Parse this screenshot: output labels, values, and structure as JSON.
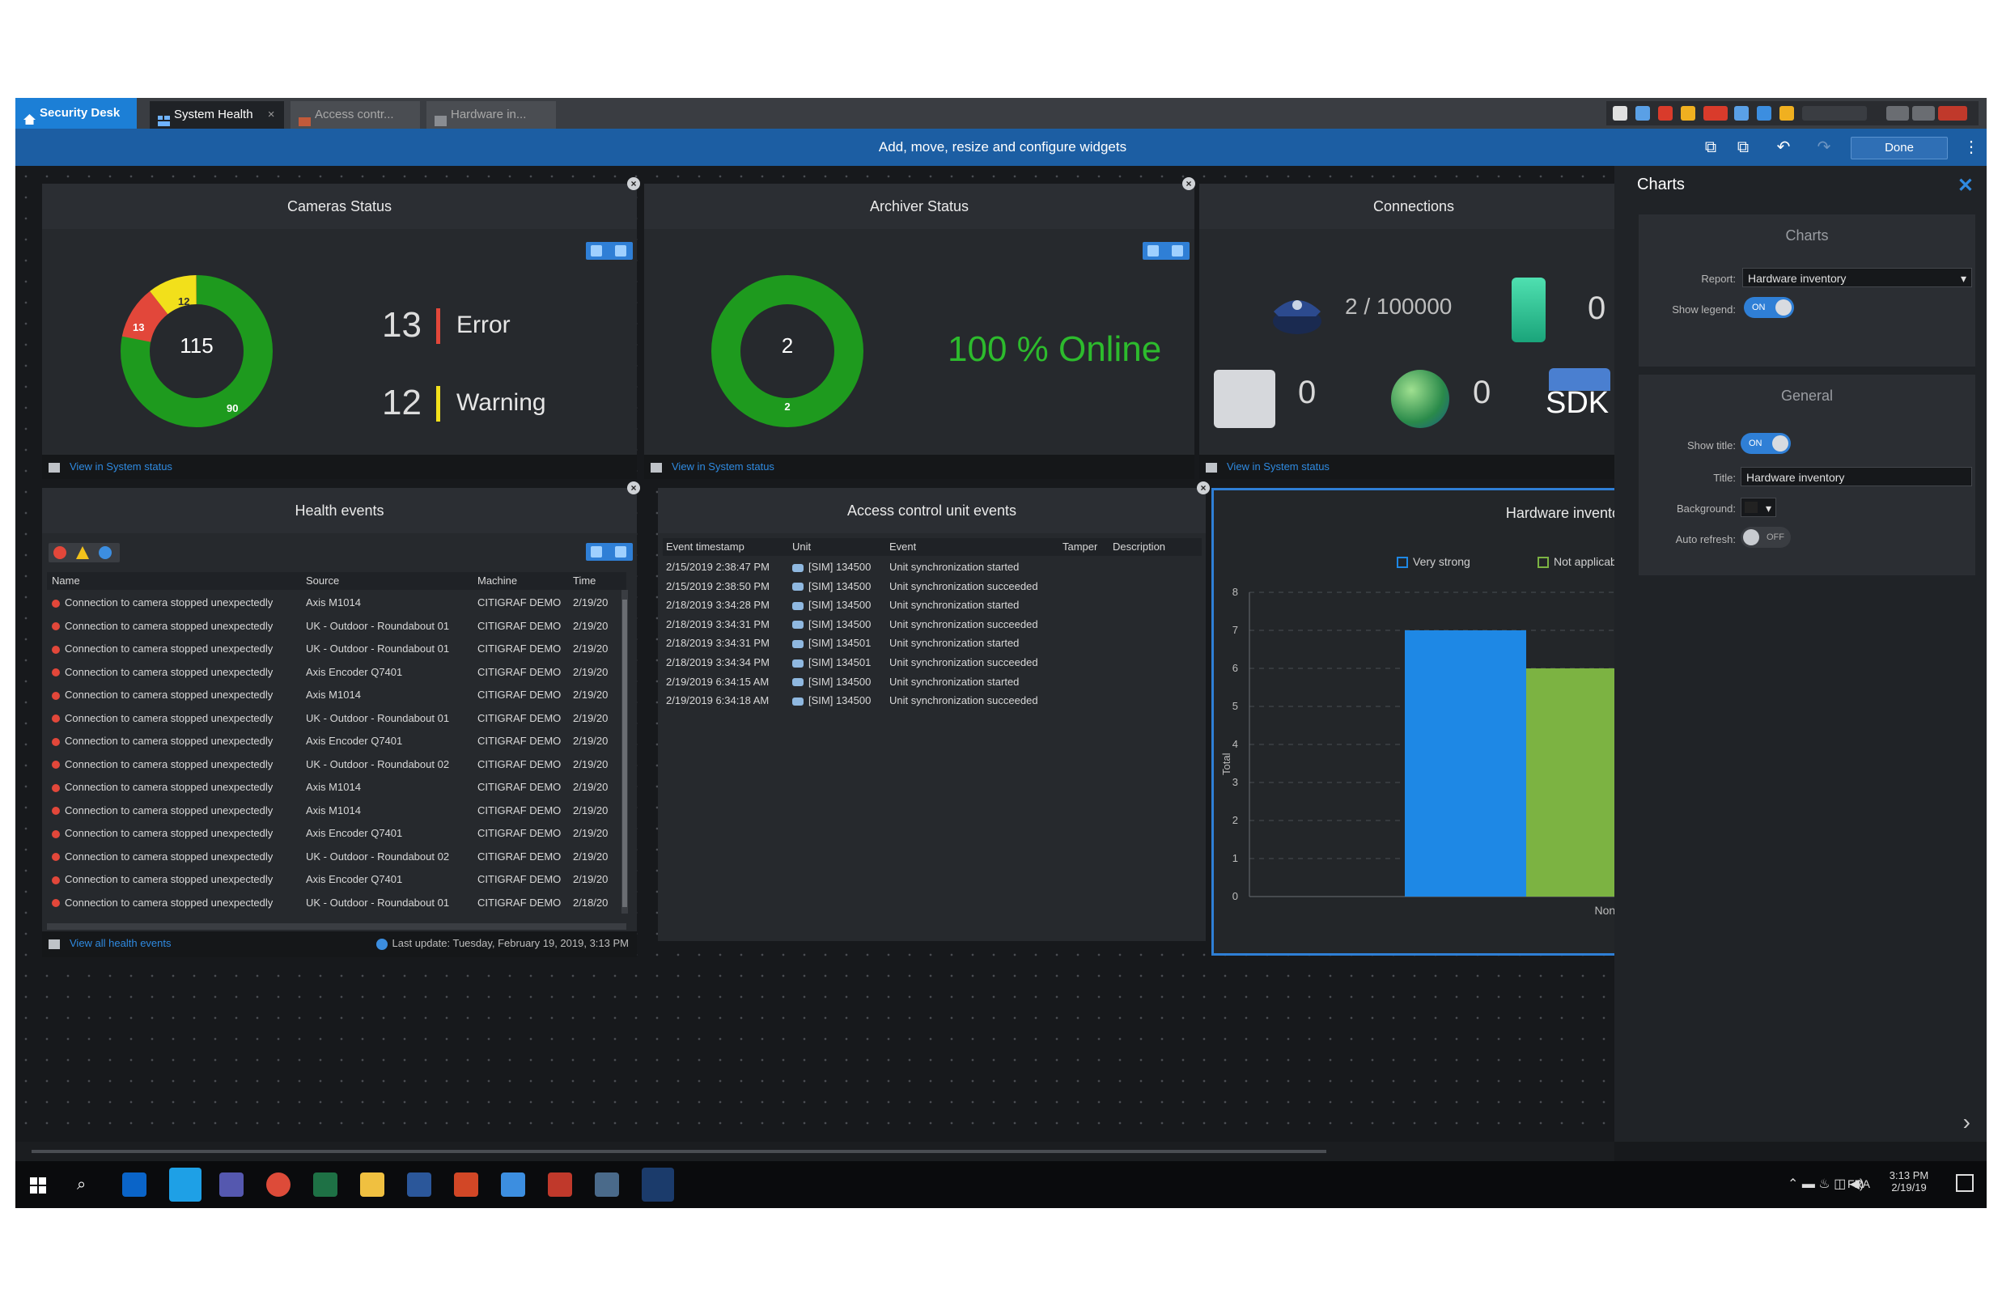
{
  "tabs": {
    "home": "Security Desk",
    "system_health": "System Health",
    "access_control": "Access contr...",
    "hardware": "Hardware in..."
  },
  "toolbar": {
    "message": "Add, move, resize and configure widgets",
    "done_label": "Done"
  },
  "cameras": {
    "title": "Cameras Status",
    "total": "115",
    "error_count": "13",
    "error_label": "Error",
    "warning_count": "12",
    "warning_label": "Warning",
    "ok_count": "90",
    "ring_error": "13",
    "ring_warning": "12",
    "footer_link": "View in System status"
  },
  "archiver": {
    "title": "Archiver Status",
    "total": "2",
    "online_count": "2",
    "online_label": "100 % Online",
    "footer_link": "View in System status"
  },
  "connections": {
    "title": "Connections",
    "officers": "2 / 100000",
    "mobile": "0",
    "servers": "0",
    "web": "0",
    "sdk_label": "SDK",
    "footer_link": "View in System status"
  },
  "health": {
    "title": "Health events",
    "columns": [
      "Name",
      "Source",
      "Machine",
      "Time"
    ],
    "rows": [
      [
        "Connection to camera stopped unexpectedly",
        "Axis M1014",
        "CITIGRAF DEMO",
        "2/19/20"
      ],
      [
        "Connection to camera stopped unexpectedly",
        "UK - Outdoor - Roundabout 01",
        "CITIGRAF DEMO",
        "2/19/20"
      ],
      [
        "Connection to camera stopped unexpectedly",
        "UK - Outdoor - Roundabout 01",
        "CITIGRAF DEMO",
        "2/19/20"
      ],
      [
        "Connection to camera stopped unexpectedly",
        "Axis Encoder Q7401",
        "CITIGRAF DEMO",
        "2/19/20"
      ],
      [
        "Connection to camera stopped unexpectedly",
        "Axis M1014",
        "CITIGRAF DEMO",
        "2/19/20"
      ],
      [
        "Connection to camera stopped unexpectedly",
        "UK - Outdoor - Roundabout 01",
        "CITIGRAF DEMO",
        "2/19/20"
      ],
      [
        "Connection to camera stopped unexpectedly",
        "Axis Encoder Q7401",
        "CITIGRAF DEMO",
        "2/19/20"
      ],
      [
        "Connection to camera stopped unexpectedly",
        "UK - Outdoor - Roundabout 02",
        "CITIGRAF DEMO",
        "2/19/20"
      ],
      [
        "Connection to camera stopped unexpectedly",
        "Axis M1014",
        "CITIGRAF DEMO",
        "2/19/20"
      ],
      [
        "Connection to camera stopped unexpectedly",
        "Axis M1014",
        "CITIGRAF DEMO",
        "2/19/20"
      ],
      [
        "Connection to camera stopped unexpectedly",
        "Axis Encoder Q7401",
        "CITIGRAF DEMO",
        "2/19/20"
      ],
      [
        "Connection to camera stopped unexpectedly",
        "UK - Outdoor - Roundabout 02",
        "CITIGRAF DEMO",
        "2/19/20"
      ],
      [
        "Connection to camera stopped unexpectedly",
        "Axis Encoder Q7401",
        "CITIGRAF DEMO",
        "2/19/20"
      ],
      [
        "Connection to camera stopped unexpectedly",
        "UK - Outdoor - Roundabout 01",
        "CITIGRAF DEMO",
        "2/18/20"
      ]
    ],
    "footer_link": "View all health events",
    "last_update": "Last update: Tuesday, February 19, 2019, 3:13 PM"
  },
  "access": {
    "title": "Access control unit events",
    "columns": [
      "Event timestamp",
      "Unit",
      "Event",
      "Tamper",
      "Description"
    ],
    "rows": [
      [
        "2/15/2019 2:38:47 PM",
        "[SIM] 134500",
        "Unit synchronization started"
      ],
      [
        "2/15/2019 2:38:50 PM",
        "[SIM] 134500",
        "Unit synchronization succeeded"
      ],
      [
        "2/18/2019 3:34:28 PM",
        "[SIM] 134500",
        "Unit synchronization started"
      ],
      [
        "2/18/2019 3:34:31 PM",
        "[SIM] 134500",
        "Unit synchronization succeeded"
      ],
      [
        "2/18/2019 3:34:31 PM",
        "[SIM] 134501",
        "Unit synchronization started"
      ],
      [
        "2/18/2019 3:34:34 PM",
        "[SIM] 134501",
        "Unit synchronization succeeded"
      ],
      [
        "2/19/2019 6:34:15 AM",
        "[SIM] 134500",
        "Unit synchronization started"
      ],
      [
        "2/19/2019 6:34:18 AM",
        "[SIM] 134500",
        "Unit synchronization succeeded"
      ]
    ]
  },
  "hardware": {
    "title": "Hardware invento",
    "legend": [
      "Very strong",
      "Not applicable"
    ],
    "y_label": "Total"
  },
  "chart_data": {
    "type": "bar",
    "categories": [
      "None"
    ],
    "series": [
      {
        "name": "Very strong",
        "values": [
          7
        ],
        "color": "#1e88e5"
      },
      {
        "name": "Not applicable",
        "values": [
          6
        ],
        "color": "#7cb342"
      }
    ],
    "ylabel": "Total",
    "ylim": [
      0,
      8
    ],
    "yticks": [
      "0",
      "1",
      "2",
      "3",
      "4",
      "5",
      "6",
      "7",
      "8"
    ],
    "grid": true,
    "legend_position": "top"
  },
  "panel": {
    "title": "Charts",
    "charts_section": "Charts",
    "report_label": "Report:",
    "report_value": "Hardware inventory",
    "legend_label": "Show legend:",
    "legend_toggle": "ON",
    "general_section": "General",
    "show_title_label": "Show title:",
    "show_title_toggle": "ON",
    "title_label": "Title:",
    "title_value": "Hardware inventory",
    "background_label": "Background:",
    "autorefresh_label": "Auto refresh:",
    "autorefresh_toggle": "OFF"
  },
  "taskbar": {
    "language": "FRA",
    "time": "3:13 PM",
    "date": "2/19/19"
  },
  "colors": {
    "accent": "#1c7fd6",
    "error": "#e2473a",
    "warning": "#f2e01b",
    "ok": "#1e9a1e",
    "online_text": "#2dbb2d"
  }
}
